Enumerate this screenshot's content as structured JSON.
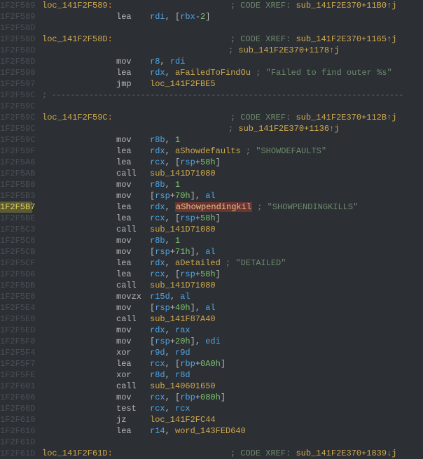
{
  "lines": [
    {
      "addr": "1F2F589",
      "type": "label",
      "label": "loc_141F2F589",
      "xref": "sub_141F2E370+11B0↑j"
    },
    {
      "addr": "1F2F589",
      "type": "ins",
      "mne": "lea",
      "ops": [
        [
          "reg",
          "rdi"
        ],
        [
          "punc",
          ", ["
        ],
        [
          "reg",
          "rbx"
        ],
        [
          "punc",
          "-"
        ],
        [
          "num",
          "2"
        ],
        [
          "punc",
          "]"
        ]
      ]
    },
    {
      "addr": "1F2F58D",
      "type": "blank"
    },
    {
      "addr": "1F2F58D",
      "type": "label",
      "label": "loc_141F2F58D",
      "xref": "sub_141F2E370+1165↑j"
    },
    {
      "addr": "1F2F58D",
      "type": "xrefcont",
      "xref": "sub_141F2E370+1178↑j"
    },
    {
      "addr": "1F2F58D",
      "type": "ins",
      "mne": "mov",
      "ops": [
        [
          "reg",
          "r8"
        ],
        [
          "punc",
          ", "
        ],
        [
          "reg",
          "rdi"
        ]
      ]
    },
    {
      "addr": "1F2F590",
      "type": "ins",
      "mne": "lea",
      "ops": [
        [
          "reg",
          "rdx"
        ],
        [
          "punc",
          ", "
        ],
        [
          "sym",
          "aFailedToFindOu"
        ]
      ],
      "tail": " ; \"Failed to find outer %s\""
    },
    {
      "addr": "1F2F597",
      "type": "ins",
      "mne": "jmp",
      "ops": [
        [
          "sym",
          "loc_141F2FBE5"
        ]
      ]
    },
    {
      "addr": "1F2F59C",
      "type": "dashes"
    },
    {
      "addr": "1F2F59C",
      "type": "blank"
    },
    {
      "addr": "1F2F59C",
      "type": "label",
      "label": "loc_141F2F59C",
      "xref": "sub_141F2E370+112B↑j"
    },
    {
      "addr": "1F2F59C",
      "type": "xrefcont",
      "xref": "sub_141F2E370+1136↑j"
    },
    {
      "addr": "1F2F59C",
      "type": "ins",
      "mne": "mov",
      "ops": [
        [
          "reg",
          "r8b"
        ],
        [
          "punc",
          ", "
        ],
        [
          "num",
          "1"
        ]
      ]
    },
    {
      "addr": "1F2F59F",
      "type": "ins",
      "mne": "lea",
      "ops": [
        [
          "reg",
          "rdx"
        ],
        [
          "punc",
          ", "
        ],
        [
          "sym",
          "aShowdefaults"
        ]
      ],
      "tail": " ; \"SHOWDEFAULTS\""
    },
    {
      "addr": "1F2F5A6",
      "type": "ins",
      "mne": "lea",
      "ops": [
        [
          "reg",
          "rcx"
        ],
        [
          "punc",
          ", ["
        ],
        [
          "reg",
          "rsp"
        ],
        [
          "punc",
          "+"
        ],
        [
          "num",
          "58h"
        ],
        [
          "punc",
          "]"
        ]
      ]
    },
    {
      "addr": "1F2F5AB",
      "type": "ins",
      "mne": "call",
      "ops": [
        [
          "sym",
          "sub_141D71080"
        ]
      ]
    },
    {
      "addr": "1F2F5B0",
      "type": "ins",
      "mne": "mov",
      "ops": [
        [
          "reg",
          "r8b"
        ],
        [
          "punc",
          ", "
        ],
        [
          "num",
          "1"
        ]
      ]
    },
    {
      "addr": "1F2F5B3",
      "type": "ins",
      "mne": "mov",
      "ops": [
        [
          "punc",
          "["
        ],
        [
          "reg",
          "rsp"
        ],
        [
          "punc",
          "+"
        ],
        [
          "num",
          "70h"
        ],
        [
          "punc",
          "], "
        ],
        [
          "reg",
          "al"
        ]
      ]
    },
    {
      "addr": "1F2F5B7",
      "type": "ins",
      "hl": true,
      "mne": "lea",
      "ops": [
        [
          "reg",
          "rdx"
        ],
        [
          "punc",
          ", "
        ],
        [
          "hlsym",
          "aShowpendingkil"
        ]
      ],
      "tail": " ; \"SHOWPENDINGKILLS\""
    },
    {
      "addr": "1F2F5BE",
      "type": "ins",
      "mne": "lea",
      "ops": [
        [
          "reg",
          "rcx"
        ],
        [
          "punc",
          ", ["
        ],
        [
          "reg",
          "rsp"
        ],
        [
          "punc",
          "+"
        ],
        [
          "num",
          "58h"
        ],
        [
          "punc",
          "]"
        ]
      ]
    },
    {
      "addr": "1F2F5C3",
      "type": "ins",
      "mne": "call",
      "ops": [
        [
          "sym",
          "sub_141D71080"
        ]
      ]
    },
    {
      "addr": "1F2F5C8",
      "type": "ins",
      "mne": "mov",
      "ops": [
        [
          "reg",
          "r8b"
        ],
        [
          "punc",
          ", "
        ],
        [
          "num",
          "1"
        ]
      ]
    },
    {
      "addr": "1F2F5CB",
      "type": "ins",
      "mne": "mov",
      "ops": [
        [
          "punc",
          "["
        ],
        [
          "reg",
          "rsp"
        ],
        [
          "punc",
          "+"
        ],
        [
          "num",
          "71h"
        ],
        [
          "punc",
          "], "
        ],
        [
          "reg",
          "al"
        ]
      ]
    },
    {
      "addr": "1F2F5CF",
      "type": "ins",
      "mne": "lea",
      "ops": [
        [
          "reg",
          "rdx"
        ],
        [
          "punc",
          ", "
        ],
        [
          "sym",
          "aDetailed"
        ]
      ],
      "tail": "  ; \"DETAILED\""
    },
    {
      "addr": "1F2F5D6",
      "type": "ins",
      "mne": "lea",
      "ops": [
        [
          "reg",
          "rcx"
        ],
        [
          "punc",
          ", ["
        ],
        [
          "reg",
          "rsp"
        ],
        [
          "punc",
          "+"
        ],
        [
          "num",
          "58h"
        ],
        [
          "punc",
          "]"
        ]
      ]
    },
    {
      "addr": "1F2F5DB",
      "type": "ins",
      "mne": "call",
      "ops": [
        [
          "sym",
          "sub_141D71080"
        ]
      ]
    },
    {
      "addr": "1F2F5E0",
      "type": "ins",
      "mne": "movzx",
      "ops": [
        [
          "reg",
          "r15d"
        ],
        [
          "punc",
          ", "
        ],
        [
          "reg",
          "al"
        ]
      ]
    },
    {
      "addr": "1F2F5E4",
      "type": "ins",
      "mne": "mov",
      "ops": [
        [
          "punc",
          "["
        ],
        [
          "reg",
          "rsp"
        ],
        [
          "punc",
          "+"
        ],
        [
          "num",
          "40h"
        ],
        [
          "punc",
          "], "
        ],
        [
          "reg",
          "al"
        ]
      ]
    },
    {
      "addr": "1F2F5E8",
      "type": "ins",
      "mne": "call",
      "ops": [
        [
          "sym",
          "sub_141F87A40"
        ]
      ]
    },
    {
      "addr": "1F2F5ED",
      "type": "ins",
      "mne": "mov",
      "ops": [
        [
          "reg",
          "rdx"
        ],
        [
          "punc",
          ", "
        ],
        [
          "reg",
          "rax"
        ]
      ]
    },
    {
      "addr": "1F2F5F0",
      "type": "ins",
      "mne": "mov",
      "ops": [
        [
          "punc",
          "["
        ],
        [
          "reg",
          "rsp"
        ],
        [
          "punc",
          "+"
        ],
        [
          "num",
          "20h"
        ],
        [
          "punc",
          "], "
        ],
        [
          "reg",
          "edi"
        ]
      ]
    },
    {
      "addr": "1F2F5F4",
      "type": "ins",
      "mne": "xor",
      "ops": [
        [
          "reg",
          "r9d"
        ],
        [
          "punc",
          ", "
        ],
        [
          "reg",
          "r9d"
        ]
      ]
    },
    {
      "addr": "1F2F5F7",
      "type": "ins",
      "mne": "lea",
      "ops": [
        [
          "reg",
          "rcx"
        ],
        [
          "punc",
          ", ["
        ],
        [
          "reg",
          "rbp"
        ],
        [
          "punc",
          "+"
        ],
        [
          "num",
          "0A0h"
        ],
        [
          "punc",
          "]"
        ]
      ]
    },
    {
      "addr": "1F2F5FE",
      "type": "ins",
      "mne": "xor",
      "ops": [
        [
          "reg",
          "r8d"
        ],
        [
          "punc",
          ", "
        ],
        [
          "reg",
          "r8d"
        ]
      ]
    },
    {
      "addr": "1F2F601",
      "type": "ins",
      "mne": "call",
      "ops": [
        [
          "sym",
          "sub_140601650"
        ]
      ]
    },
    {
      "addr": "1F2F606",
      "type": "ins",
      "mne": "mov",
      "ops": [
        [
          "reg",
          "rcx"
        ],
        [
          "punc",
          ", ["
        ],
        [
          "reg",
          "rbp"
        ],
        [
          "punc",
          "+"
        ],
        [
          "num",
          "080h"
        ],
        [
          "punc",
          "]"
        ]
      ]
    },
    {
      "addr": "1F2F60D",
      "type": "ins",
      "mne": "test",
      "ops": [
        [
          "reg",
          "rcx"
        ],
        [
          "punc",
          ", "
        ],
        [
          "reg",
          "rcx"
        ]
      ]
    },
    {
      "addr": "1F2F610",
      "type": "ins",
      "mne": "jz",
      "ops": [
        [
          "sym",
          "loc_141F2FC44"
        ]
      ]
    },
    {
      "addr": "1F2F616",
      "type": "ins",
      "mne": "lea",
      "ops": [
        [
          "reg",
          "r14"
        ],
        [
          "punc",
          ", "
        ],
        [
          "sym",
          "word_143FED640"
        ]
      ]
    },
    {
      "addr": "1F2F61D",
      "type": "blank"
    },
    {
      "addr": "1F2F61D",
      "type": "label",
      "label": "loc_141F2F61D",
      "xref": "sub_141F2E370+1839↓j"
    }
  ],
  "xref_prefix": "; CODE XREF: ",
  "dashrow": "; ---------------------------------------------------------------------------"
}
